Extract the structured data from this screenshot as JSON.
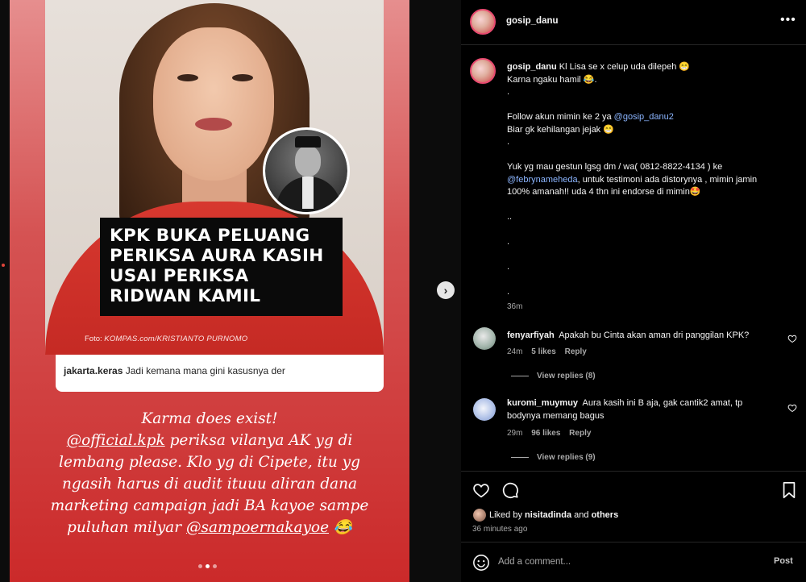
{
  "post": {
    "image": {
      "headline": [
        "KPK BUKA PELUANG",
        "PERIKSA AURA KASIH",
        "USAI PERIKSA",
        "RIDWAN KAMIL"
      ],
      "photo_credit_prefix": "Foto:",
      "photo_credit": "KOMPAS.com/KRISTIANTO PURNOMO",
      "embedded_comment": {
        "user": "jakarta.keras",
        "text": "Jadi kemana mana gini kasusnya der"
      },
      "overlay_caption": {
        "line1": "Karma does exist!",
        "line2_mention": "@official.kpk",
        "line2_rest": " periksa vilanya AK yg di",
        "line3": "lembang please. Klo yg di Cipete, itu yg",
        "line4": "ngasih harus di audit ituuu aliran dana",
        "line5": "marketing campaign jadi BA kayoe sampe",
        "line6_start": "puluhan milyar ",
        "line6_mention": "@sampoernakayoe",
        "line6_emoji": "😂"
      },
      "carousel": {
        "count": 3,
        "active": 2
      }
    }
  },
  "header": {
    "username": "gosip_danu",
    "more_glyph": "•••"
  },
  "caption": {
    "username": "gosip_danu",
    "line1": "Kl Lisa se x celup uda dilepeh 😁",
    "line2": "Karna ngaku hamil 😂.",
    "dot1": ".",
    "line3_text": "Follow akun mimin ke 2 ya ",
    "line3_mention": "@gosip_danu2",
    "line4": "Biar gk kehilangan jejak 😁",
    "dot2": ".",
    "line5": "Yuk yg mau gestun lgsg dm / wa( 0812-8822-4134 ) ke",
    "line6_mention": "@febrynameheda",
    "line6_rest": ", untuk testimoni ada distorynya , mimin jamin",
    "line7": "100% amanah!! uda 4 thn ini endorse di mimin🤩",
    "dash": "..",
    "dot3": ".",
    "dot4": ".",
    "dot5": ".",
    "time": "36m"
  },
  "comments": [
    {
      "user": "fenyarfiyah",
      "text": "Apakah bu Cinta akan aman dri panggilan KPK?",
      "time": "24m",
      "likes": "5 likes",
      "reply": "Reply",
      "view_replies": "View replies (8)"
    },
    {
      "user": "kuromi_muymuy",
      "text": "Aura kasih ini B aja, gak cantik2 amat, tp bodynya memang bagus",
      "time": "29m",
      "likes": "96 likes",
      "reply": "Reply",
      "view_replies": "View replies (9)"
    }
  ],
  "likes": {
    "prefix": "Liked by ",
    "user": "nisitadinda",
    "and": " and ",
    "others": "others"
  },
  "post_time": "36 minutes ago",
  "add_comment": {
    "placeholder": "Add a comment...",
    "post_label": "Post"
  },
  "colors": {
    "mention": "#8bb5ff",
    "panel_bg": "#000000",
    "story_red": "#cb2a2a"
  },
  "icons": [
    "more-icon",
    "heart-icon",
    "comment-icon",
    "save-icon",
    "emoji-icon",
    "chevron-right-icon"
  ]
}
